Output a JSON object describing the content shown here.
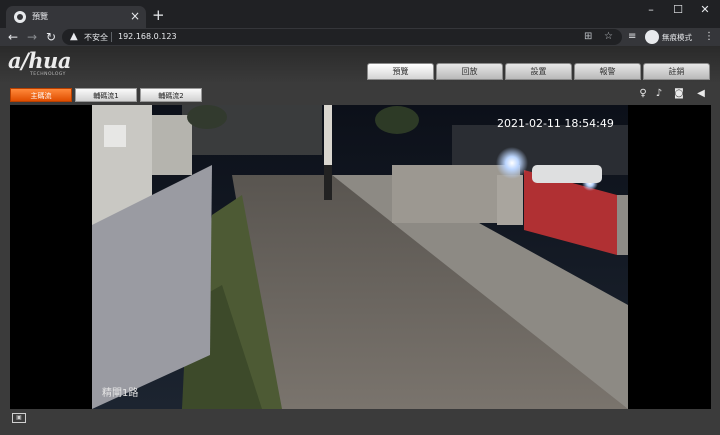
{
  "browser": {
    "tab_title": "預覽",
    "tab_close": "×",
    "new_tab": "+",
    "window_controls": [
      "–",
      "☐",
      "✕"
    ],
    "nav_icons": [
      "back-icon",
      "forward-icon",
      "reload-icon"
    ],
    "security_label": "不安全",
    "url": "192.168.0.123",
    "omnibox_icons": [
      "translate-icon",
      "star-icon"
    ],
    "right_icons": [
      "media-icon",
      "incognito-icon",
      "menu-icon"
    ],
    "incognito_label": "無痕模式"
  },
  "app": {
    "logo": "a/hua",
    "logo_sub": "TECHNOLOGY",
    "main_tabs": [
      {
        "label": "預覽",
        "active": true
      },
      {
        "label": "回放",
        "active": false
      },
      {
        "label": "設置",
        "active": false
      },
      {
        "label": "報警",
        "active": false
      },
      {
        "label": "註銷",
        "active": false
      }
    ],
    "streams": [
      {
        "label": "主碼流",
        "active": true
      },
      {
        "label": "輔碼流1",
        "active": false
      },
      {
        "label": "輔碼流2",
        "active": false
      }
    ],
    "tool_icons": [
      "bulb-icon",
      "bell-icon",
      "camera-icon",
      "speaker-icon"
    ],
    "accent_color": "#e85c0d"
  },
  "video": {
    "timestamp": "2021-02-11 18:54:49",
    "osd_name": "精閘1路"
  }
}
